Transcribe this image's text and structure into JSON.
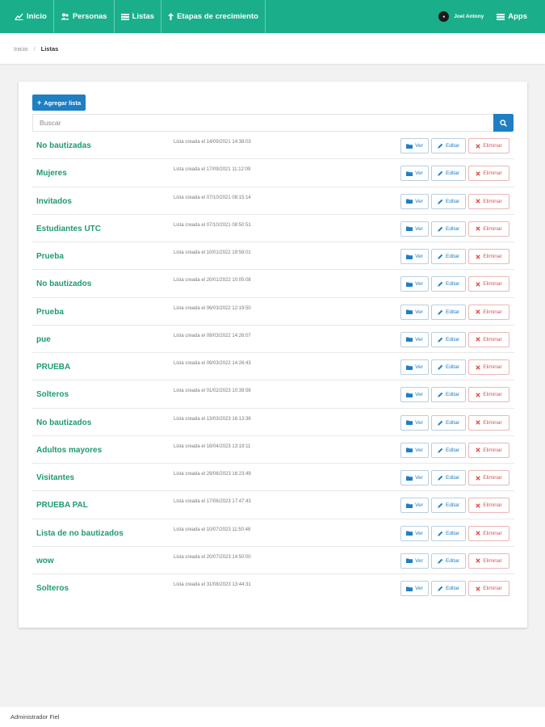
{
  "nav": {
    "items": [
      {
        "label": "Inicio",
        "icon": "chart-icon"
      },
      {
        "label": "Personas",
        "icon": "users-icon"
      },
      {
        "label": "Listas",
        "icon": "list-icon"
      },
      {
        "label": "Etapas de crecimiento",
        "icon": "arrow-up-icon"
      }
    ],
    "user_name": "Joel Antony",
    "apps_label": "Apps"
  },
  "breadcrumb": {
    "home": "Inicio",
    "separator": "/",
    "current": "Listas"
  },
  "toolbar": {
    "add_label": "Agregar lista",
    "search_placeholder": "Buscar"
  },
  "actions": {
    "view": "Ver",
    "edit": "Editar",
    "delete": "Eliminar"
  },
  "lists": [
    {
      "name": "No bautizadas",
      "created": "Lista creada el 14/09/2021 14:38:03"
    },
    {
      "name": "Mujeres",
      "created": "Lista creada el 17/09/2021 11:12:09"
    },
    {
      "name": "Invitados",
      "created": "Lista creada el 07/10/2021 08:15:14"
    },
    {
      "name": "Estudiantes UTC",
      "created": "Lista creada el 07/10/2021 08:50:51"
    },
    {
      "name": "Prueba",
      "created": "Lista creada el 10/01/2022 19:58:01"
    },
    {
      "name": "No bautizados",
      "created": "Lista creada el 20/01/2022 10:05:08"
    },
    {
      "name": "Prueba",
      "created": "Lista creada el 06/03/2022 12:19:50"
    },
    {
      "name": "pue",
      "created": "Lista creada el 09/03/2022 14:26:07"
    },
    {
      "name": "PRUEBA",
      "created": "Lista creada el 09/03/2022 14:26:43"
    },
    {
      "name": "Solteros",
      "created": "Lista creada el 01/02/2023 10:39:56"
    },
    {
      "name": "No bautizados",
      "created": "Lista creada el 13/03/2023 16:13:36"
    },
    {
      "name": "Adultos mayores",
      "created": "Lista creada el 18/04/2023 13:19:11"
    },
    {
      "name": "Visitantes",
      "created": "Lista creada el 29/06/2023 16:23:49"
    },
    {
      "name": "PRUEBA PAL",
      "created": "Lista creada el 17/06/2023 17:47:43"
    },
    {
      "name": "Lista de no bautizados",
      "created": "Lista creada el 10/07/2023 11:50:48"
    },
    {
      "name": "wow",
      "created": "Lista creada el 20/07/2023 14:50:00"
    },
    {
      "name": "Solteros",
      "created": "Lista creada el 31/08/2023 13:44:31"
    }
  ],
  "footer": {
    "text": "Administrador Fiel"
  },
  "colors": {
    "brand": "#1aaf8a",
    "link_green": "#1f9b6d",
    "primary": "#1e7fc3",
    "danger": "#d9534f"
  }
}
